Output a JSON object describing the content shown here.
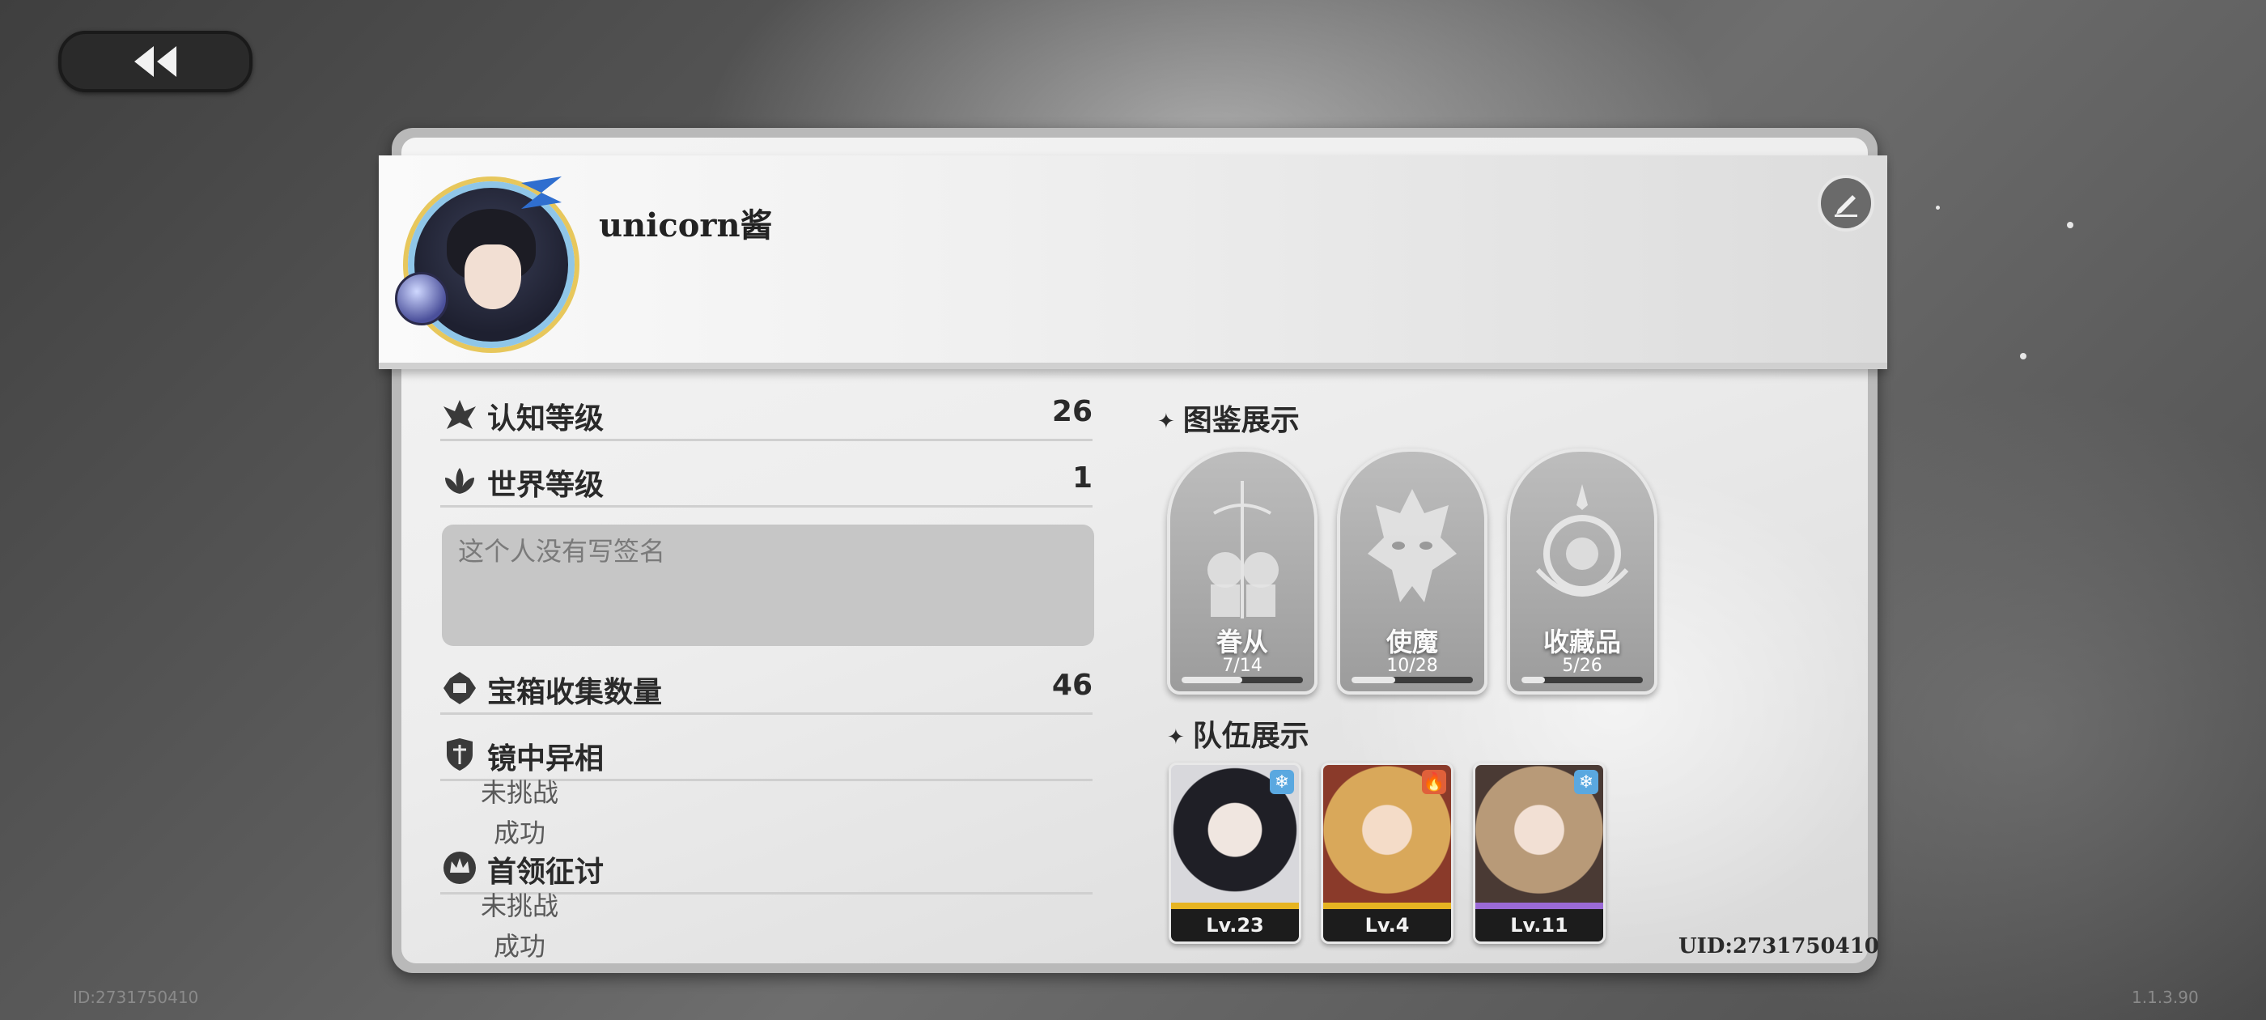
{
  "profile": {
    "username": "unicorn酱",
    "uid_label": "UID:2731750410"
  },
  "stats": {
    "cognition_label": "认知等级",
    "cognition_value": "26",
    "world_label": "世界等级",
    "world_value": "1",
    "signature_placeholder": "这个人没有写签名",
    "chest_label": "宝箱收集数量",
    "chest_value": "46",
    "mirror_label": "镜中异相",
    "mirror_status1": "未挑战",
    "mirror_status2": "成功",
    "boss_label": "首领征讨",
    "boss_status1": "未挑战",
    "boss_status2": "成功"
  },
  "archives": {
    "title": "图鉴展示",
    "items": [
      {
        "label": "眷从",
        "count": "7/14",
        "progress": 0.5
      },
      {
        "label": "使魔",
        "count": "10/28",
        "progress": 0.357
      },
      {
        "label": "收藏品",
        "count": "5/26",
        "progress": 0.192
      }
    ]
  },
  "team": {
    "title": "队伍展示",
    "members": [
      {
        "level": "Lv.23",
        "element": "ice",
        "rarity_color": "#e6b422"
      },
      {
        "level": "Lv.4",
        "element": "fire",
        "rarity_color": "#e6b422"
      },
      {
        "level": "Lv.11",
        "element": "ice",
        "rarity_color": "#9b6ad6"
      }
    ]
  },
  "footer": {
    "id_text": "ID:2731750410",
    "version": "1.1.3.90"
  },
  "icons": {
    "back": "double-chevron-left-icon",
    "edit": "pen-edit-icon",
    "star": "four-point-star-icon"
  }
}
